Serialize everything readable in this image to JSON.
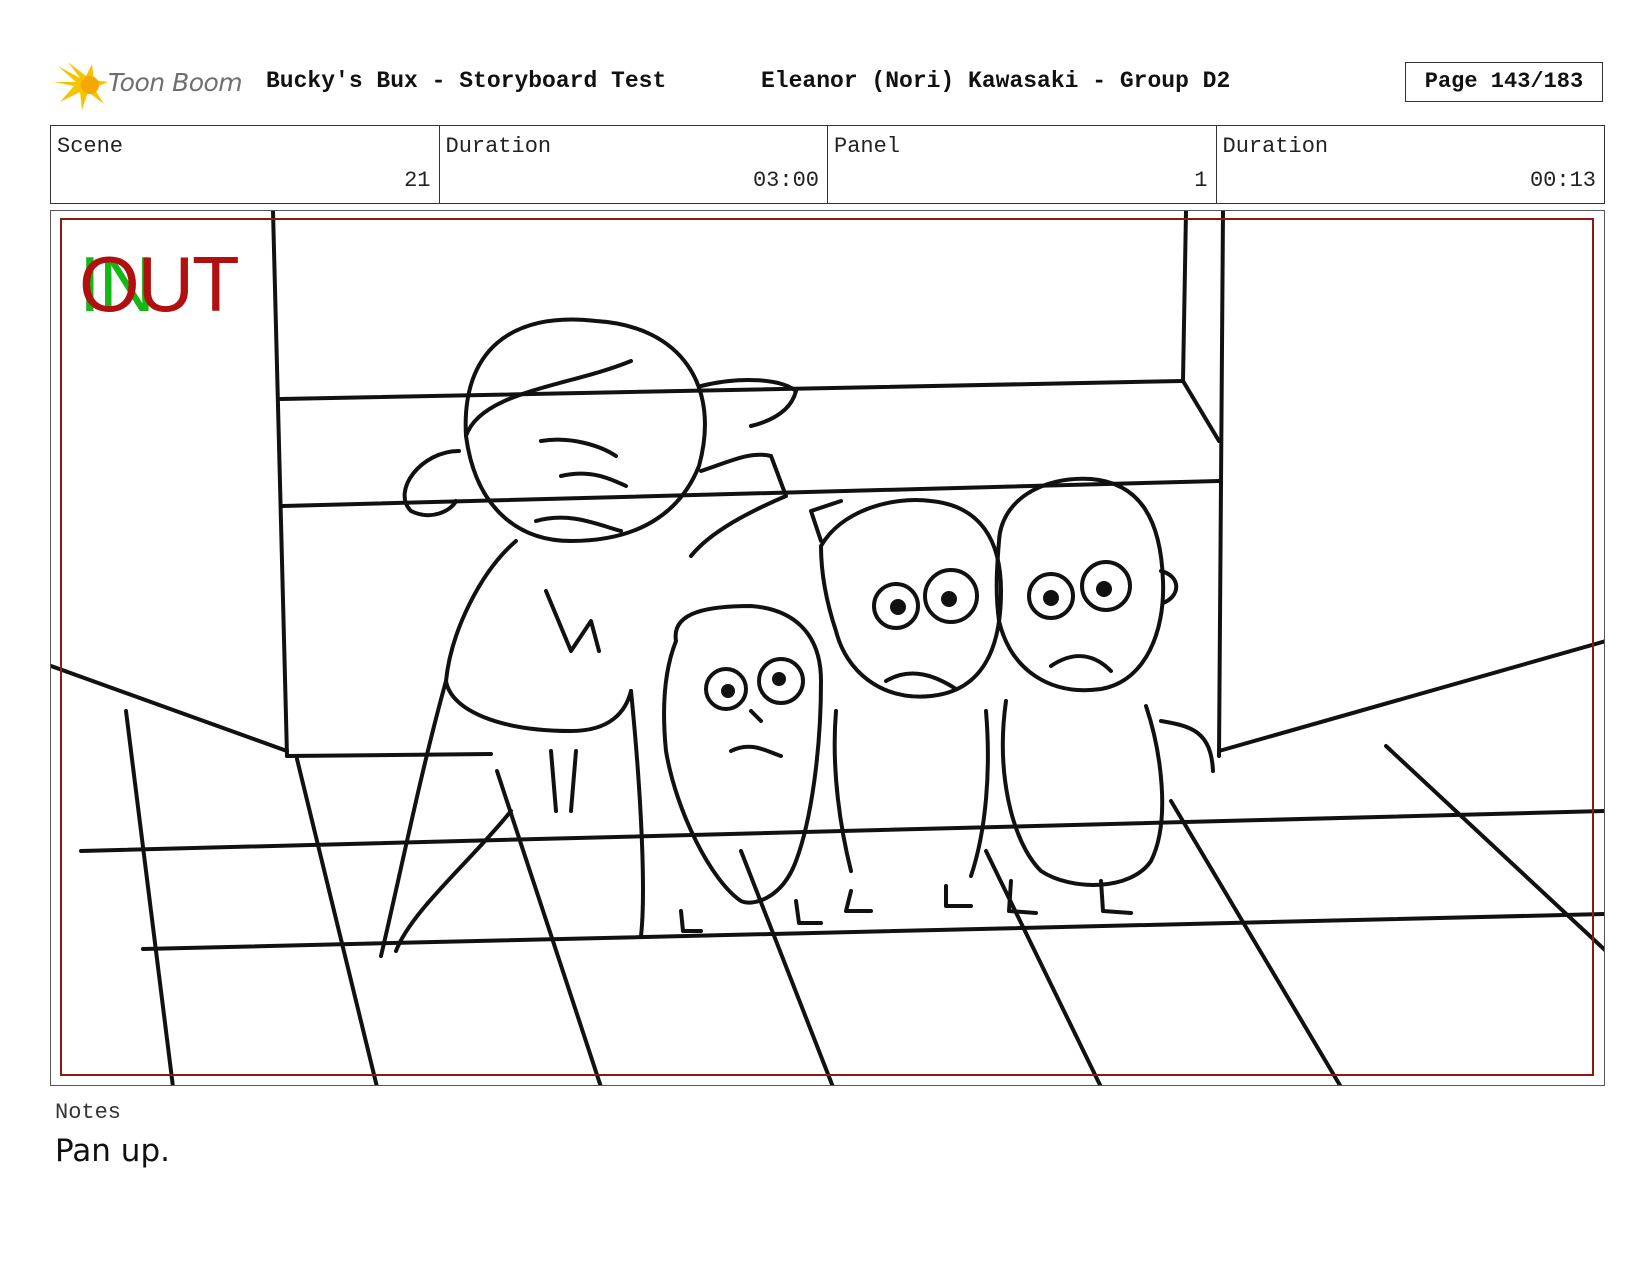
{
  "header": {
    "logo_text": "Toon Boom",
    "title": "Bucky's Bux - Storyboard Test",
    "artist": "Eleanor (Nori) Kawasaki - Group D2",
    "page": "Page 143/183"
  },
  "info": {
    "scene": {
      "label": "Scene",
      "value": "21"
    },
    "scene_duration": {
      "label": "Duration",
      "value": "03:00"
    },
    "panel": {
      "label": "Panel",
      "value": "1"
    },
    "panel_duration": {
      "label": "Duration",
      "value": "00:13"
    }
  },
  "panel": {
    "in_label": "IN",
    "out_label": "OUT",
    "frame_color": "#8b1a10",
    "in_color": "#14b814",
    "out_color": "#b01010"
  },
  "notes": {
    "label": "Notes",
    "text": "Pan up."
  }
}
